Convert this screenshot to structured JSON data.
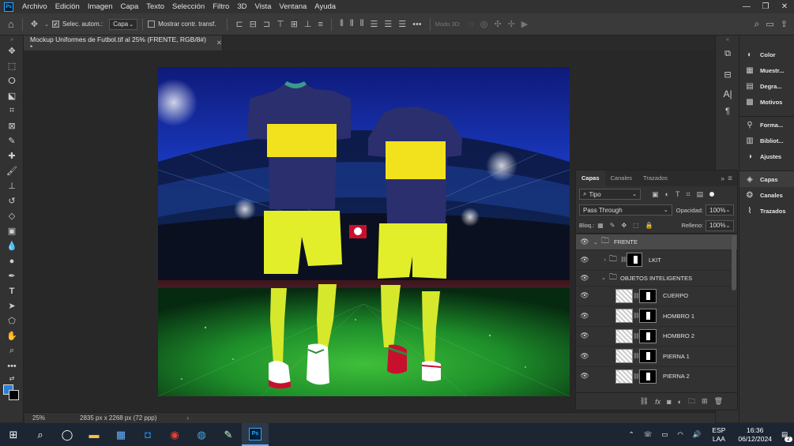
{
  "menubar": {
    "logo": "Ps",
    "items": [
      "Archivo",
      "Edición",
      "Imagen",
      "Capa",
      "Texto",
      "Selección",
      "Filtro",
      "3D",
      "Vista",
      "Ventana",
      "Ayuda"
    ]
  },
  "options": {
    "auto_select_label": "Selec. autom.:",
    "auto_select_value": "Capa",
    "transform_label": "Mostrar contr. transf.",
    "mode3d": "Modo 3D:"
  },
  "document": {
    "tab_title": "Mockup Uniformes de Futbol.tif al 25% (FRENTE, RGB/8#) *",
    "zoom": "25%",
    "size": "2835 px x 2268 px (72 ppp)"
  },
  "right_panels": {
    "top": [
      {
        "icon": "color-icon",
        "label": "Color"
      },
      {
        "icon": "swatches-icon",
        "label": "Muestr..."
      },
      {
        "icon": "gradient-icon",
        "label": "Degra..."
      },
      {
        "icon": "patterns-icon",
        "label": "Motivos"
      },
      {
        "icon": "shapes-icon",
        "label": "Forma..."
      },
      {
        "icon": "libraries-icon",
        "label": "Bibliot..."
      },
      {
        "icon": "adjustments-icon",
        "label": "Ajustes"
      }
    ],
    "bottom": [
      {
        "icon": "layers-icon",
        "label": "Capas"
      },
      {
        "icon": "channels-icon",
        "label": "Canales"
      },
      {
        "icon": "paths-icon",
        "label": "Trazados"
      }
    ]
  },
  "layers_panel": {
    "tabs": [
      "Capas",
      "Canales",
      "Trazados"
    ],
    "filter_kind": "Tipo",
    "blend_mode": "Pass Through",
    "opacity_label": "Opacidad:",
    "opacity": "100%",
    "lock_label": "Bloq.:",
    "fill_label": "Relleno:",
    "fill": "100%",
    "layers": [
      {
        "name": "FRENTE",
        "type": "group",
        "indent": 0
      },
      {
        "name": "LKIT",
        "type": "group-masked",
        "indent": 1
      },
      {
        "name": "OBJETOS INTELIGENTES",
        "type": "group",
        "indent": 1
      },
      {
        "name": "CUERPO",
        "type": "smart",
        "indent": 2
      },
      {
        "name": "HOMBRO 1",
        "type": "smart",
        "indent": 2
      },
      {
        "name": "HOMBRO 2",
        "type": "smart",
        "indent": 2
      },
      {
        "name": "PIERNA 1",
        "type": "smart",
        "indent": 2
      },
      {
        "name": "PIERNA 2",
        "type": "smart",
        "indent": 2
      }
    ]
  },
  "taskbar": {
    "lang1": "ESP",
    "lang2": "LAA",
    "time": "16:36",
    "date": "06/12/2024",
    "notifications": "2"
  },
  "colors": {
    "jersey_navy": "#2b2f6e",
    "jersey_yellow": "#f2e21d",
    "shorts_yellow": "#e3ee2a",
    "pitch_green": "#1e8f2a",
    "sky_blue": "#1b3ec9"
  }
}
